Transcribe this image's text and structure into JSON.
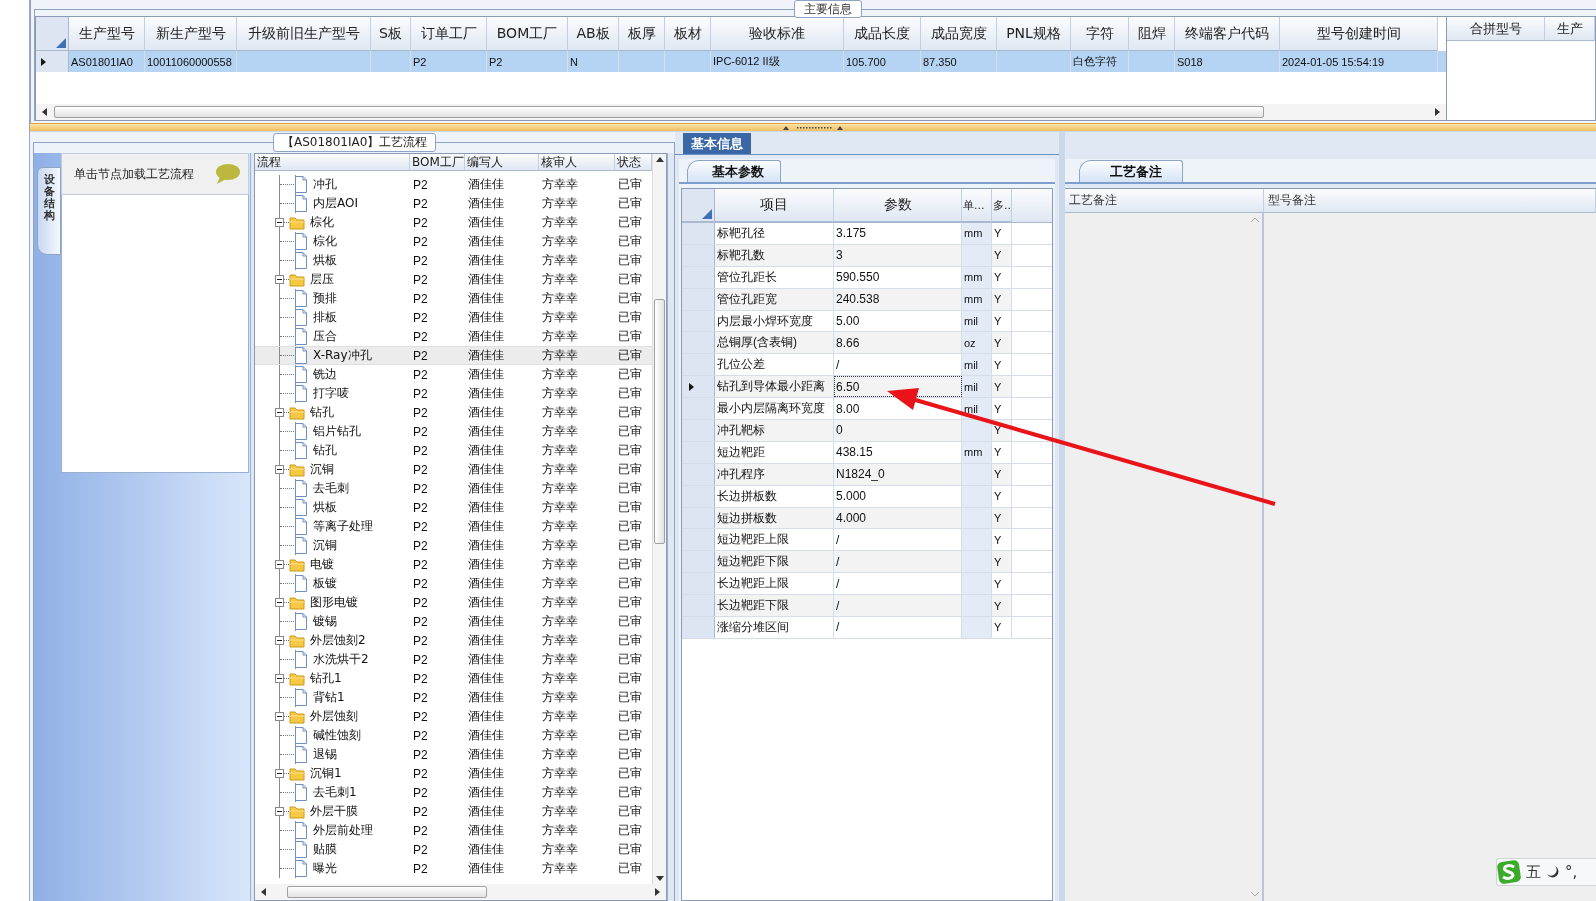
{
  "main_info": {
    "title": "主要信息",
    "columns": [
      "生产型号",
      "新生产型号",
      "升级前旧生产型号",
      "S板",
      "订单工厂",
      "BOM工厂",
      "AB板",
      "板厚",
      "板材",
      "验收标准",
      "成品长度",
      "成品宽度",
      "PNL规格",
      "字符",
      "阻焊",
      "终端客户代码",
      "型号创建时间"
    ],
    "rows": [
      {
        "selected": true,
        "cells": [
          "AS01801IA0",
          "10011060000558",
          null,
          null,
          "P2",
          "P2",
          "N",
          null,
          null,
          "IPC-6012 II级",
          "105.700",
          "87.350",
          null,
          "白色字符",
          null,
          "S018",
          "2024-01-05 15:54:19"
        ]
      }
    ]
  },
  "merge_grid": {
    "columns": [
      "合拼型号",
      "生产"
    ]
  },
  "flow": {
    "title": "【AS01801IA0】工艺流程",
    "side_tab": "设备结构",
    "hint": "单击节点加载工艺流程",
    "columns": [
      "流程",
      "BOM工厂",
      "编写人",
      "核审人",
      "状态"
    ],
    "tree": [
      {
        "kind": "offscreen",
        "children": [
          {
            "kind": "file",
            "label": "冲孔",
            "bom": "P2",
            "writer": "酒佳佳",
            "reviewer": "方幸幸",
            "status": "已审",
            "selected": false
          },
          {
            "kind": "file",
            "label": "内层AOI",
            "bom": "P2",
            "writer": "酒佳佳",
            "reviewer": "方幸幸",
            "status": "已审",
            "selected": false
          }
        ]
      },
      {
        "kind": "folder",
        "label": "棕化",
        "bom": "P2",
        "writer": "酒佳佳",
        "reviewer": "方幸幸",
        "status": "已审",
        "selected": false,
        "expanded": true,
        "children": [
          {
            "kind": "file",
            "label": "棕化",
            "bom": "P2",
            "writer": "酒佳佳",
            "reviewer": "方幸幸",
            "status": "已审",
            "selected": false
          },
          {
            "kind": "file",
            "label": "烘板",
            "bom": "P2",
            "writer": "酒佳佳",
            "reviewer": "方幸幸",
            "status": "已审",
            "selected": false
          }
        ]
      },
      {
        "kind": "folder",
        "label": "层压",
        "bom": "P2",
        "writer": "酒佳佳",
        "reviewer": "方幸幸",
        "status": "已审",
        "selected": false,
        "expanded": true,
        "children": [
          {
            "kind": "file",
            "label": "预排",
            "bom": "P2",
            "writer": "酒佳佳",
            "reviewer": "方幸幸",
            "status": "已审",
            "selected": false
          },
          {
            "kind": "file",
            "label": "排板",
            "bom": "P2",
            "writer": "酒佳佳",
            "reviewer": "方幸幸",
            "status": "已审",
            "selected": false
          },
          {
            "kind": "file",
            "label": "压合",
            "bom": "P2",
            "writer": "酒佳佳",
            "reviewer": "方幸幸",
            "status": "已审",
            "selected": false
          },
          {
            "kind": "file",
            "label": "X-Ray冲孔",
            "bom": "P2",
            "writer": "酒佳佳",
            "reviewer": "方幸幸",
            "status": "已审",
            "selected": true
          },
          {
            "kind": "file",
            "label": "铣边",
            "bom": "P2",
            "writer": "酒佳佳",
            "reviewer": "方幸幸",
            "status": "已审",
            "selected": false
          },
          {
            "kind": "file",
            "label": "打字唛",
            "bom": "P2",
            "writer": "酒佳佳",
            "reviewer": "方幸幸",
            "status": "已审",
            "selected": false
          }
        ]
      },
      {
        "kind": "folder",
        "label": "钻孔",
        "bom": "P2",
        "writer": "酒佳佳",
        "reviewer": "方幸幸",
        "status": "已审",
        "selected": false,
        "expanded": true,
        "children": [
          {
            "kind": "file",
            "label": "铝片钻孔",
            "bom": "P2",
            "writer": "酒佳佳",
            "reviewer": "方幸幸",
            "status": "已审",
            "selected": false
          },
          {
            "kind": "file",
            "label": "钻孔",
            "bom": "P2",
            "writer": "酒佳佳",
            "reviewer": "方幸幸",
            "status": "已审",
            "selected": false
          }
        ]
      },
      {
        "kind": "folder",
        "label": "沉铜",
        "bom": "P2",
        "writer": "酒佳佳",
        "reviewer": "方幸幸",
        "status": "已审",
        "selected": false,
        "expanded": true,
        "children": [
          {
            "kind": "file",
            "label": "去毛刺",
            "bom": "P2",
            "writer": "酒佳佳",
            "reviewer": "方幸幸",
            "status": "已审",
            "selected": false
          },
          {
            "kind": "file",
            "label": "烘板",
            "bom": "P2",
            "writer": "酒佳佳",
            "reviewer": "方幸幸",
            "status": "已审",
            "selected": false
          },
          {
            "kind": "file",
            "label": "等离子处理",
            "bom": "P2",
            "writer": "酒佳佳",
            "reviewer": "方幸幸",
            "status": "已审",
            "selected": false
          },
          {
            "kind": "file",
            "label": "沉铜",
            "bom": "P2",
            "writer": "酒佳佳",
            "reviewer": "方幸幸",
            "status": "已审",
            "selected": false
          }
        ]
      },
      {
        "kind": "folder",
        "label": "电镀",
        "bom": "P2",
        "writer": "酒佳佳",
        "reviewer": "方幸幸",
        "status": "已审",
        "selected": false,
        "expanded": true,
        "children": [
          {
            "kind": "file",
            "label": "板镀",
            "bom": "P2",
            "writer": "酒佳佳",
            "reviewer": "方幸幸",
            "status": "已审",
            "selected": false
          }
        ]
      },
      {
        "kind": "folder",
        "label": "图形电镀",
        "bom": "P2",
        "writer": "酒佳佳",
        "reviewer": "方幸幸",
        "status": "已审",
        "selected": false,
        "expanded": true,
        "children": [
          {
            "kind": "file",
            "label": "镀锡",
            "bom": "P2",
            "writer": "酒佳佳",
            "reviewer": "方幸幸",
            "status": "已审",
            "selected": false
          }
        ]
      },
      {
        "kind": "folder",
        "label": "外层蚀刻2",
        "bom": "P2",
        "writer": "酒佳佳",
        "reviewer": "方幸幸",
        "status": "已审",
        "selected": false,
        "expanded": true,
        "children": [
          {
            "kind": "file",
            "label": "水洗烘干2",
            "bom": "P2",
            "writer": "酒佳佳",
            "reviewer": "方幸幸",
            "status": "已审",
            "selected": false
          }
        ]
      },
      {
        "kind": "folder",
        "label": "钻孔1",
        "bom": "P2",
        "writer": "酒佳佳",
        "reviewer": "方幸幸",
        "status": "已审",
        "selected": false,
        "expanded": true,
        "children": [
          {
            "kind": "file",
            "label": "背钻1",
            "bom": "P2",
            "writer": "酒佳佳",
            "reviewer": "方幸幸",
            "status": "已审",
            "selected": false
          }
        ]
      },
      {
        "kind": "folder",
        "label": "外层蚀刻",
        "bom": "P2",
        "writer": "酒佳佳",
        "reviewer": "方幸幸",
        "status": "已审",
        "selected": false,
        "expanded": true,
        "children": [
          {
            "kind": "file",
            "label": "碱性蚀刻",
            "bom": "P2",
            "writer": "酒佳佳",
            "reviewer": "方幸幸",
            "status": "已审",
            "selected": false
          },
          {
            "kind": "file",
            "label": "退锡",
            "bom": "P2",
            "writer": "酒佳佳",
            "reviewer": "方幸幸",
            "status": "已审",
            "selected": false
          }
        ]
      },
      {
        "kind": "folder",
        "label": "沉铜1",
        "bom": "P2",
        "writer": "酒佳佳",
        "reviewer": "方幸幸",
        "status": "已审",
        "selected": false,
        "expanded": true,
        "children": [
          {
            "kind": "file",
            "label": "去毛刺1",
            "bom": "P2",
            "writer": "酒佳佳",
            "reviewer": "方幸幸",
            "status": "已审",
            "selected": false
          }
        ]
      },
      {
        "kind": "folder",
        "label": "外层干膜",
        "bom": "P2",
        "writer": "酒佳佳",
        "reviewer": "方幸幸",
        "status": "已审",
        "selected": false,
        "expanded": true,
        "children": [
          {
            "kind": "file",
            "label": "外层前处理",
            "bom": "P2",
            "writer": "酒佳佳",
            "reviewer": "方幸幸",
            "status": "已审",
            "selected": false
          },
          {
            "kind": "file",
            "label": "贴膜",
            "bom": "P2",
            "writer": "酒佳佳",
            "reviewer": "方幸幸",
            "status": "已审",
            "selected": false
          },
          {
            "kind": "file",
            "label": "曝光",
            "bom": "P2",
            "writer": "酒佳佳",
            "reviewer": "方幸幸",
            "status": "已审",
            "selected": false
          }
        ]
      }
    ]
  },
  "info": {
    "tab": "基本信息",
    "subtab": "基本参数",
    "columns": [
      "项目",
      "参数",
      "单...",
      "多.."
    ],
    "rows": [
      {
        "item": "标靶孔径",
        "value": "3.175",
        "unit": "mm",
        "flag": "Y",
        "selected": false
      },
      {
        "item": "标靶孔数",
        "value": "3",
        "flag": "Y",
        "selected": false
      },
      {
        "item": "管位孔距长",
        "value": "590.550",
        "unit": "mm",
        "flag": "Y",
        "selected": false
      },
      {
        "item": "管位孔距宽",
        "value": "240.538",
        "unit": "mm",
        "flag": "Y",
        "selected": false
      },
      {
        "item": "内层最小焊环宽度",
        "value": "5.00",
        "unit": "mil",
        "flag": "Y",
        "selected": false
      },
      {
        "item": "总铜厚(含表铜)",
        "value": "8.66",
        "unit": "oz",
        "flag": "Y",
        "selected": false
      },
      {
        "item": "孔位公差",
        "value": "/",
        "unit": "mil",
        "flag": "Y",
        "selected": false
      },
      {
        "item": "钻孔到导体最小距离",
        "value": "6.50",
        "unit": "mil",
        "flag": "Y",
        "selected": true
      },
      {
        "item": "最小内层隔离环宽度",
        "value": "8.00",
        "unit": "mil",
        "flag": "Y",
        "selected": false
      },
      {
        "item": "冲孔靶标",
        "value": "0",
        "flag": "Y",
        "selected": false
      },
      {
        "item": "短边靶距",
        "value": "438.15",
        "unit": "mm",
        "flag": "Y",
        "selected": false
      },
      {
        "item": "冲孔程序",
        "value": "N1824_0",
        "flag": "Y",
        "selected": false
      },
      {
        "item": "长边拼板数",
        "value": "5.000",
        "flag": "Y",
        "selected": false
      },
      {
        "item": "短边拼板数",
        "value": "4.000",
        "flag": "Y",
        "selected": false
      },
      {
        "item": "短边靶距上限",
        "value": "/",
        "flag": "Y",
        "selected": false
      },
      {
        "item": "短边靶距下限",
        "value": "/",
        "flag": "Y",
        "selected": false
      },
      {
        "item": "长边靶距上限",
        "value": "/",
        "flag": "Y",
        "selected": false
      },
      {
        "item": "长边靶距下限",
        "value": "/",
        "flag": "Y",
        "selected": false
      },
      {
        "item": "涨缩分堆区间",
        "value": "/",
        "flag": "Y",
        "selected": false
      }
    ]
  },
  "notes": {
    "subtab": "工艺备注",
    "columns": [
      "工艺备注",
      "型号备注"
    ]
  },
  "ime": {
    "mode": "五",
    "punct": "°,"
  }
}
